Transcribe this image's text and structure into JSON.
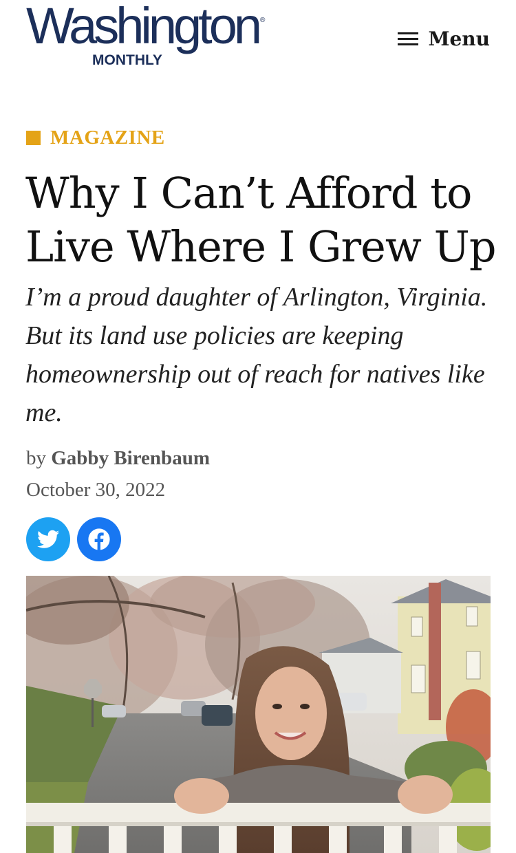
{
  "header": {
    "logo_word": "Washington",
    "logo_sub": "MONTHLY",
    "logo_reg": "®",
    "menu_label": "Menu",
    "brand_color": "#1c2f5a"
  },
  "article": {
    "category": "MAGAZINE",
    "category_color": "#e4a317",
    "title": "Why I Can’t Afford to Live Where I Grew Up",
    "dek": "I’m a proud daughter of Arlington, Virginia. But its land use policies are keeping homeownership out of reach for natives like me.",
    "byline_prefix": "by",
    "author": "Gabby Birenbaum",
    "date": "October 30, 2022"
  },
  "share": {
    "twitter_icon": "twitter-icon",
    "facebook_icon": "facebook-icon",
    "twitter_color": "#1da1f2",
    "facebook_color": "#1877f2"
  },
  "hero_image": {
    "subject": "hero-photo"
  }
}
